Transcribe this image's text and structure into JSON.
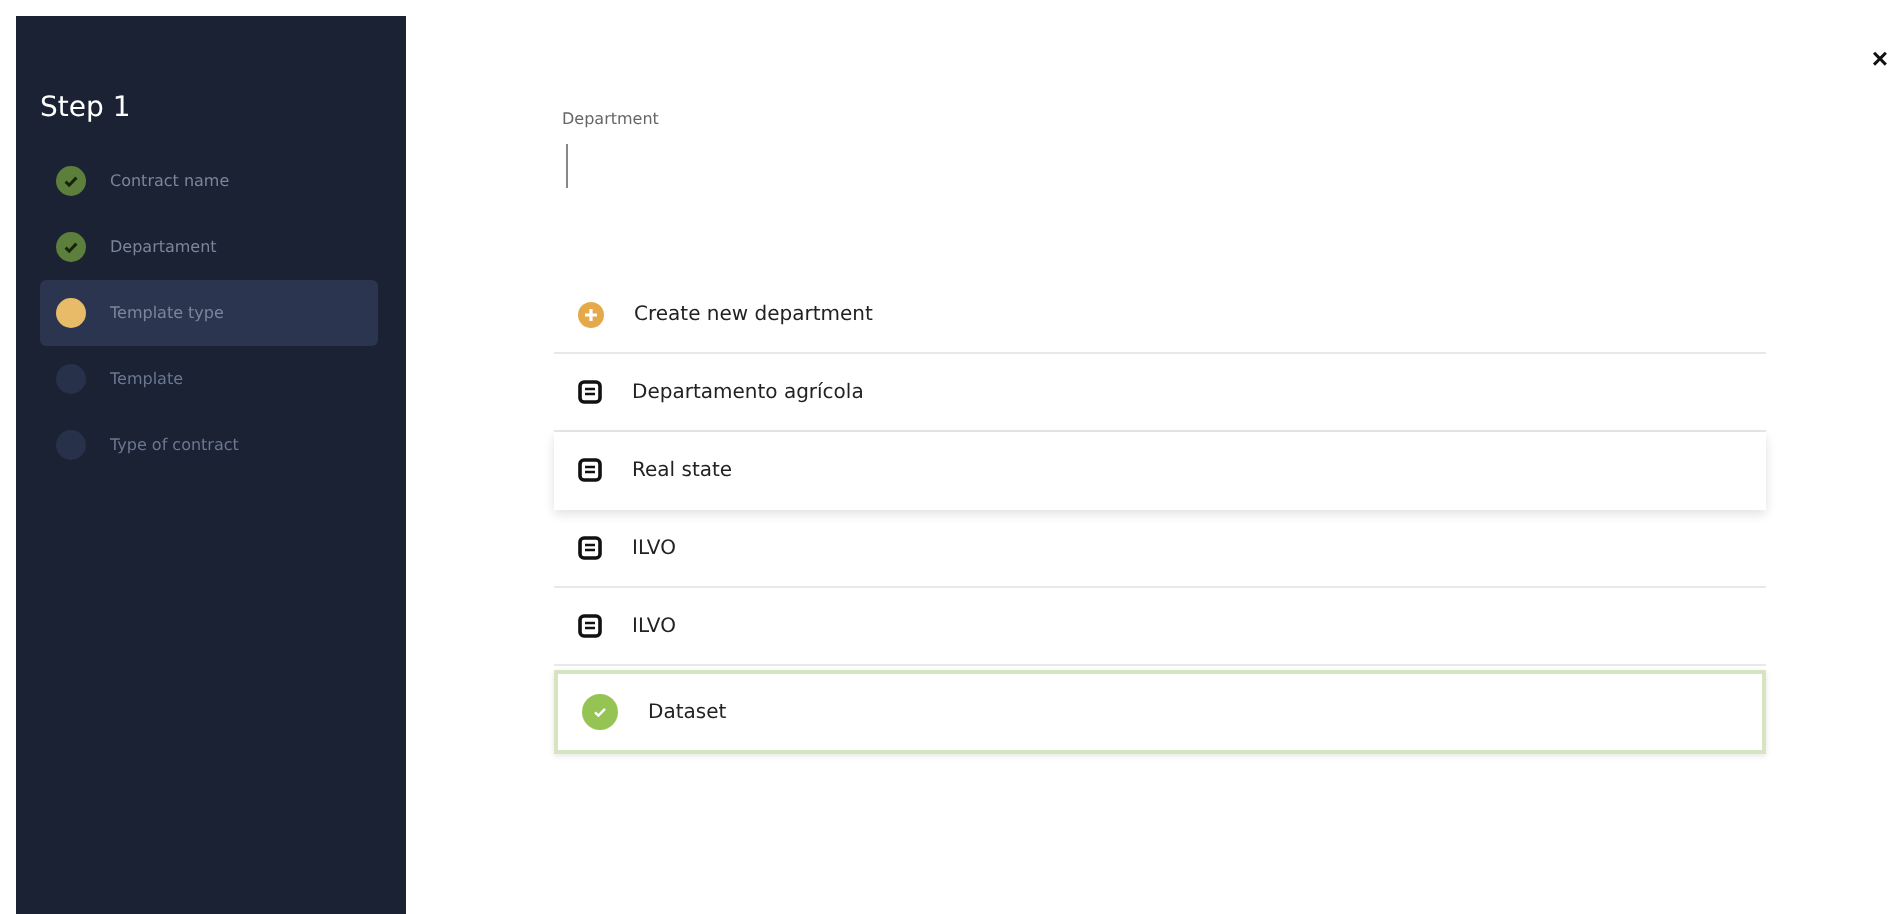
{
  "sidebar": {
    "title": "Step 1",
    "steps": [
      {
        "label": "Contract name",
        "kind": "done"
      },
      {
        "label": "Departament",
        "kind": "done"
      },
      {
        "label": "Template type",
        "kind": "current"
      },
      {
        "label": "Template",
        "kind": "pending"
      },
      {
        "label": "Type of contract",
        "kind": "pending"
      }
    ]
  },
  "close": "×",
  "department_field": {
    "label": "Department"
  },
  "options": [
    {
      "kind": "create",
      "label": "Create new department",
      "hovered": false,
      "selected": false
    },
    {
      "kind": "option",
      "label": "Departamento agrícola",
      "hovered": false,
      "selected": false
    },
    {
      "kind": "option",
      "label": "Real state",
      "hovered": true,
      "selected": false
    },
    {
      "kind": "option",
      "label": "ILVO",
      "hovered": false,
      "selected": false
    },
    {
      "kind": "option",
      "label": "ILVO",
      "hovered": false,
      "selected": false
    },
    {
      "kind": "option",
      "label": "Dataset",
      "hovered": false,
      "selected": true
    }
  ]
}
